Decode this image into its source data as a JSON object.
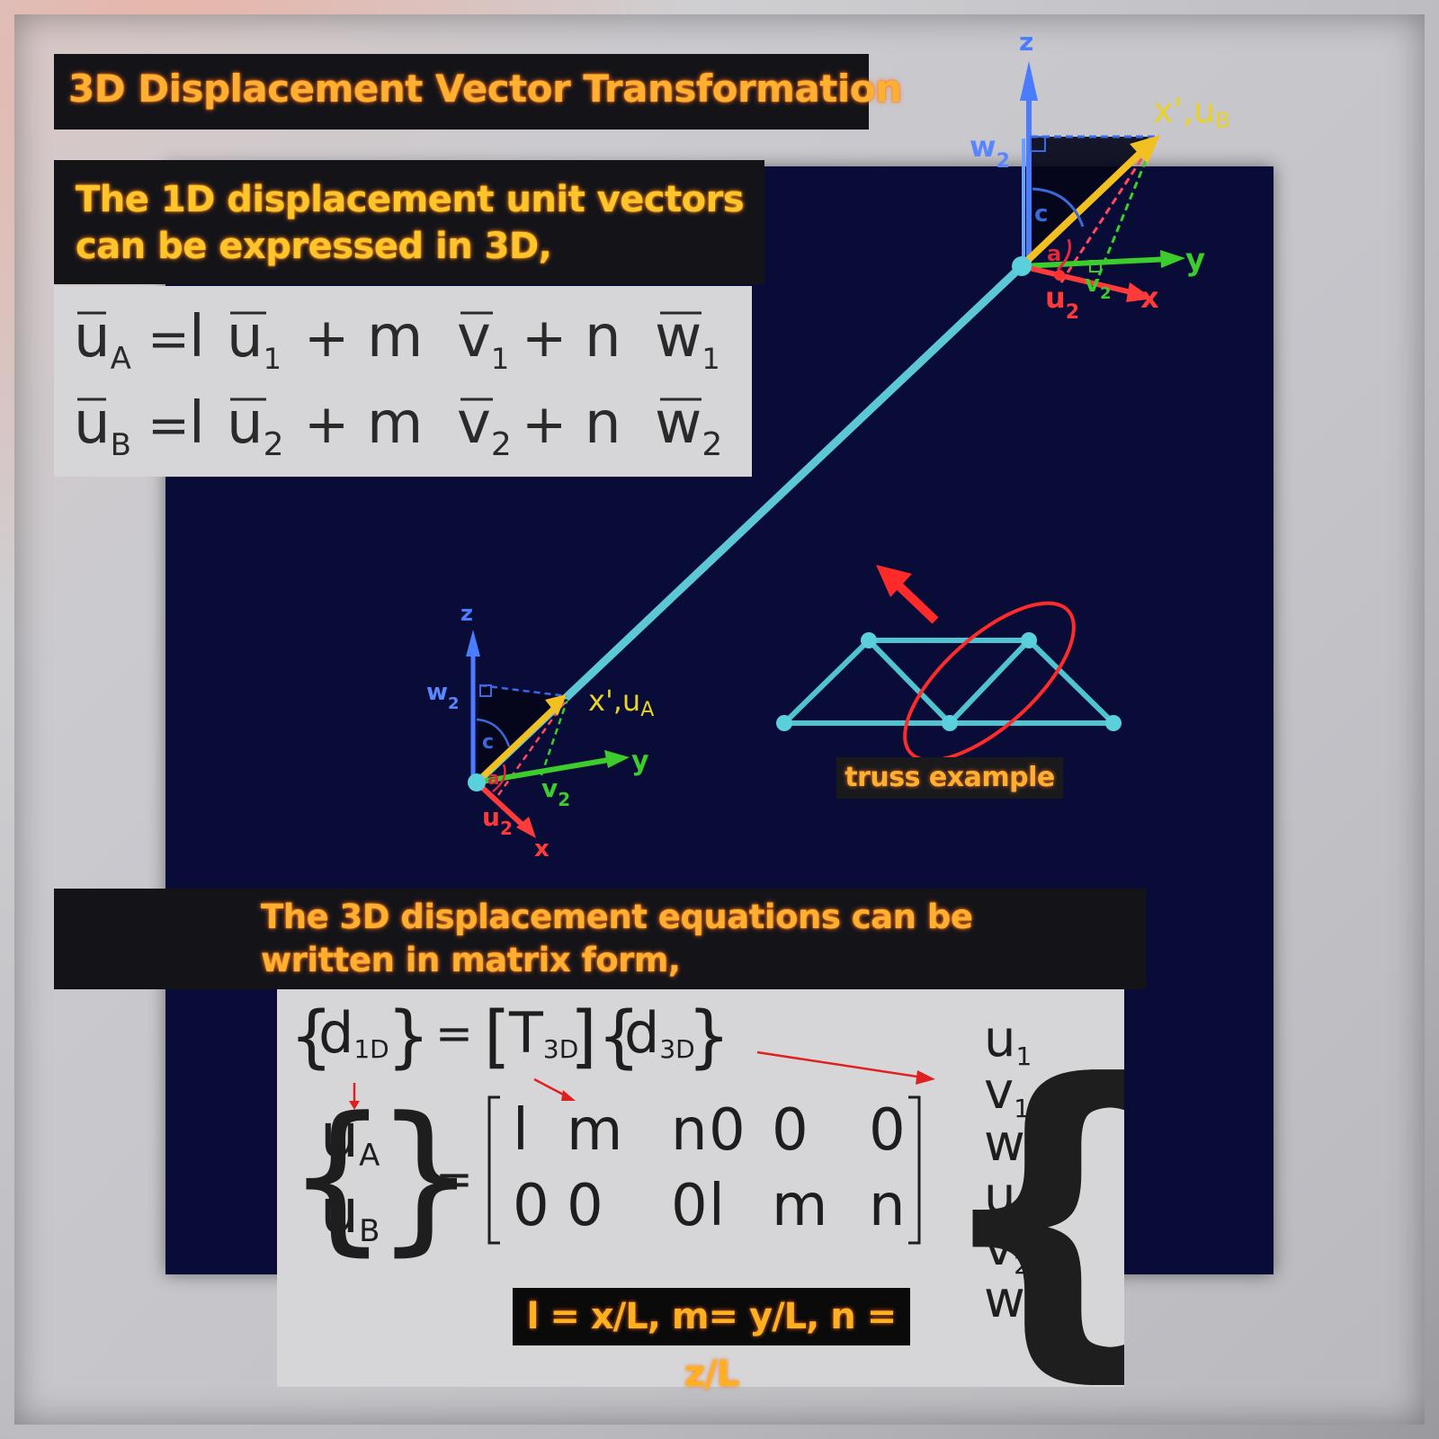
{
  "title": "3D Displacement Vector Transformation",
  "intro": {
    "line1": "The 1D displacement unit vectors",
    "line2": "can be expressed in 3D,"
  },
  "unit_vector_equations": {
    "eq_a": {
      "lhs": "u",
      "lhs_sub": "A",
      "c1": "l",
      "v1": "u",
      "s1": "1",
      "c2": "m",
      "v2": "v",
      "s2": "1",
      "c3": "n",
      "v3": "w",
      "s3": "1"
    },
    "eq_b": {
      "lhs": "u",
      "lhs_sub": "B",
      "c1": "l",
      "v1": "u",
      "s1": "2",
      "c2": "m",
      "v2": "v",
      "s2": "2",
      "c3": "n",
      "v3": "w",
      "s3": "2"
    }
  },
  "scene": {
    "node_b_labels": {
      "z": "z",
      "x_prime": "x',u",
      "x_prime_sub": "B",
      "w": "w",
      "w_sub": "2",
      "y": "y",
      "x": "x",
      "u": "u",
      "u_sub": "2",
      "v": "v",
      "v_sub": "2",
      "c": "c",
      "a": "a"
    },
    "node_a_labels": {
      "z": "z",
      "x_prime": "x',u",
      "x_prime_sub": "A",
      "w": "w",
      "w_sub": "2",
      "y": "y",
      "x": "x",
      "u": "u",
      "u_sub": "2",
      "v": "v",
      "v_sub": "2",
      "c": "c",
      "a": "a"
    },
    "truss_label": "truss example"
  },
  "matrix_form": {
    "line1": "The 3D displacement equations can be",
    "line2": "written in matrix form,",
    "d1d": "d",
    "d1d_sub": "1D",
    "t3d": "T",
    "t3d_sub": "3D",
    "d3d": "d",
    "d3d_sub": "3D",
    "lhs_vector": [
      {
        "v": "u",
        "s": "A"
      },
      {
        "v": "u",
        "s": "B"
      }
    ],
    "matrix_rows": [
      [
        "l",
        "m",
        "n",
        "0",
        "0",
        "0"
      ],
      [
        "0",
        "0",
        "0",
        "l",
        "m",
        "n"
      ]
    ],
    "rhs_vector": [
      {
        "v": "u",
        "s": "1"
      },
      {
        "v": "v",
        "s": "1"
      },
      {
        "v": "w",
        "s": "1"
      },
      {
        "v": "u",
        "s": "2"
      },
      {
        "v": "v",
        "s": "2"
      },
      {
        "v": "w",
        "s": "2"
      }
    ],
    "cosines": "l = x/L, m= y/L, n = z/L"
  },
  "colors": {
    "board": "#080c36",
    "member": "#5ad0dc",
    "z_axis": "#4a7cff",
    "y_axis": "#3ccc2c",
    "x_axis": "#ff3a3a",
    "x_prime": "#f2c020",
    "banner_text": "#ffb030",
    "highlight": "#ff2a2a"
  }
}
